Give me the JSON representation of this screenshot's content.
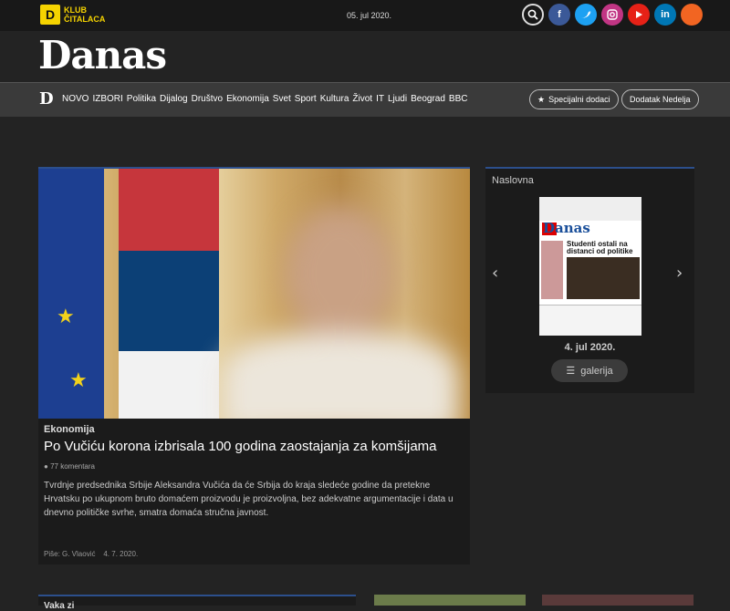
{
  "topbar": {
    "club_line1": "KLUB",
    "club_line2": "ČITALACA",
    "club_logo": "D",
    "date": "05. jul 2020.",
    "socials": [
      "search-icon",
      "facebook-icon",
      "twitter-icon",
      "instagram-icon",
      "youtube-icon",
      "linkedin-icon",
      "rss-icon"
    ]
  },
  "brand": {
    "logo": "Danas",
    "nav_logo": "D"
  },
  "nav": {
    "items": [
      "NOVO",
      "IZBORI",
      "Politika",
      "Dijalog",
      "Društvo",
      "Ekonomija",
      "Svet",
      "Sport",
      "Kultura",
      "Život",
      "IT",
      "Ljudi",
      "Beograd",
      "BBC"
    ],
    "special_label": "Specijalni dodaci",
    "nedelja_label": "Dodatak Nedelja"
  },
  "article": {
    "category": "Ekonomija",
    "title": "Po Vučiću korona izbrisala 100 godina zaostajanja za komšijama",
    "comments": "77 komentara",
    "lead": "Tvrdnje predsednika Srbije Aleksandra Vučića da će Srbija do kraja sledeće godine da pretekne Hrvatsku po ukupnom bruto domaćem proizvodu je proizvoljna, bez adekvatne argumentacije i data u dnevno političke svrhe, smatra domaća stručna javnost.",
    "byline_author": "Piše: G. Vlaović",
    "byline_date": "4. 7. 2020."
  },
  "sidebar": {
    "title": "Naslovna",
    "cover_date": "4. jul 2020.",
    "gallery_label": "galerija",
    "cover_logo": "Danas",
    "cover_headline": "Studenti ostali na distanci od politike"
  },
  "bottom": {
    "first_title": "Vaka zi"
  },
  "colors": {
    "accent": "#2c4f8c",
    "brand_yellow": "#f5d300"
  }
}
